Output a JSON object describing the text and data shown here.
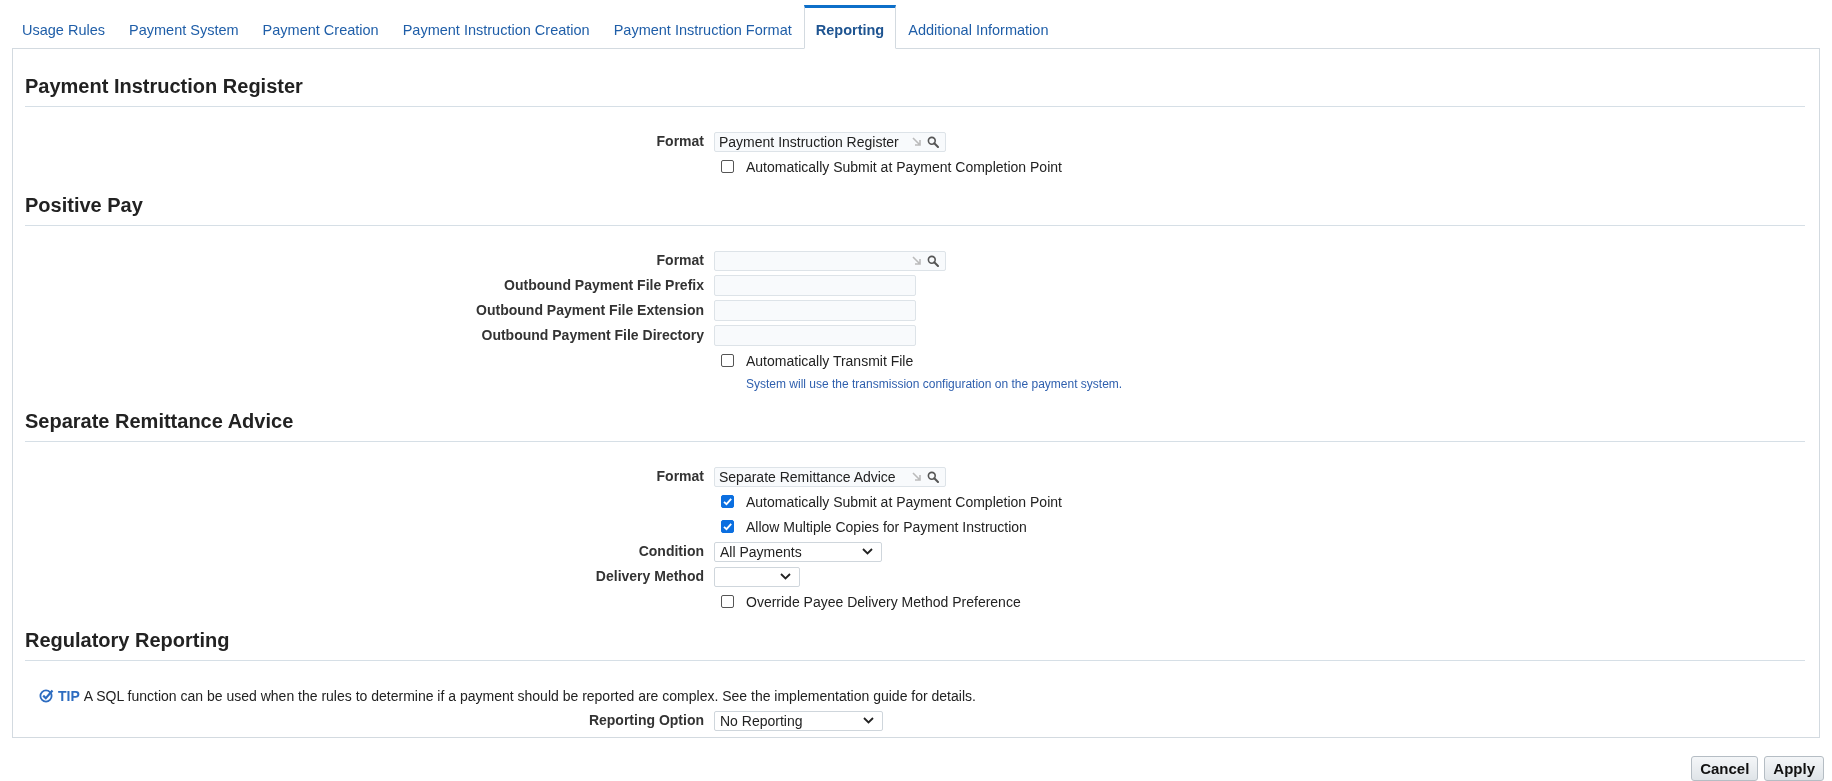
{
  "tabs": [
    {
      "label": "Usage Rules",
      "selected": false
    },
    {
      "label": "Payment System",
      "selected": false
    },
    {
      "label": "Payment Creation",
      "selected": false
    },
    {
      "label": "Payment Instruction Creation",
      "selected": false
    },
    {
      "label": "Payment Instruction Format",
      "selected": false
    },
    {
      "label": "Reporting",
      "selected": true
    },
    {
      "label": "Additional Information",
      "selected": false
    }
  ],
  "sections": [
    {
      "title": "Payment Instruction Register",
      "rows": [
        {
          "kind": "lookup",
          "label": "Format",
          "value": "Payment Instruction Register"
        },
        {
          "kind": "checkbox",
          "label": "Automatically Submit at Payment Completion Point",
          "checked": false
        }
      ]
    },
    {
      "title": "Positive Pay",
      "rows": [
        {
          "kind": "lookup",
          "label": "Format"
        },
        {
          "kind": "text",
          "label": "Outbound Payment File Prefix"
        },
        {
          "kind": "text",
          "label": "Outbound Payment File Extension"
        },
        {
          "kind": "text",
          "label": "Outbound Payment File Directory"
        },
        {
          "kind": "checkbox",
          "label": "Automatically Transmit File",
          "checked": false
        },
        {
          "kind": "hint",
          "text": "System will use the transmission configuration on the payment system."
        }
      ]
    },
    {
      "title": "Separate Remittance Advice",
      "rows": [
        {
          "kind": "lookup",
          "label": "Format",
          "value": "Separate Remittance Advice"
        },
        {
          "kind": "checkbox",
          "label": "Automatically Submit at Payment Completion Point",
          "checked": true
        },
        {
          "kind": "checkbox",
          "label": "Allow Multiple Copies for Payment Instruction",
          "checked": true
        },
        {
          "kind": "select",
          "label": "Condition",
          "value": "All Payments"
        },
        {
          "kind": "select",
          "label": "Delivery Method"
        },
        {
          "kind": "checkbox",
          "label": "Override Payee Delivery Method Preference",
          "checked": false
        }
      ]
    },
    {
      "title": "Regulatory Reporting",
      "rows": [
        {
          "kind": "tip",
          "badge": "TIP",
          "text": "A SQL function can be used when the rules to determine if a payment should be reported are complex. See the implementation guide for details."
        },
        {
          "kind": "select",
          "label": "Reporting Option",
          "value": "No Reporting"
        }
      ]
    }
  ],
  "buttons": [
    {
      "label": "Cancel"
    },
    {
      "label": "Apply"
    }
  ]
}
